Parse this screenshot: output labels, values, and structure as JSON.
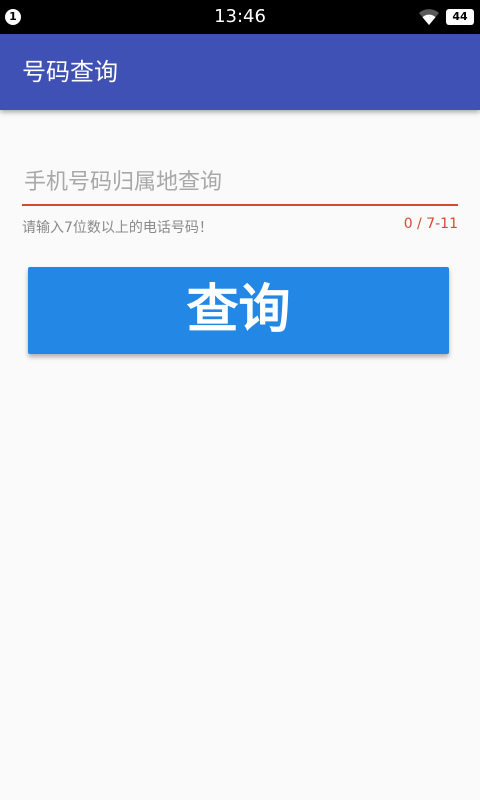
{
  "status_bar": {
    "notification_count": "1",
    "time": "13:46",
    "battery_level": "44",
    "icons": [
      "notification-badge-icon",
      "wifi-icon",
      "battery-icon"
    ]
  },
  "app_bar": {
    "title": "号码查询",
    "color": "#3f51b5"
  },
  "form": {
    "input_placeholder": "手机号码归属地查询",
    "input_value": "",
    "helper_text": "请输入7位数以上的电话号码！",
    "counter_text": "0 / 7-11",
    "error_color": "#d84a2f",
    "button_label": "查询",
    "button_color": "#2388e5"
  }
}
